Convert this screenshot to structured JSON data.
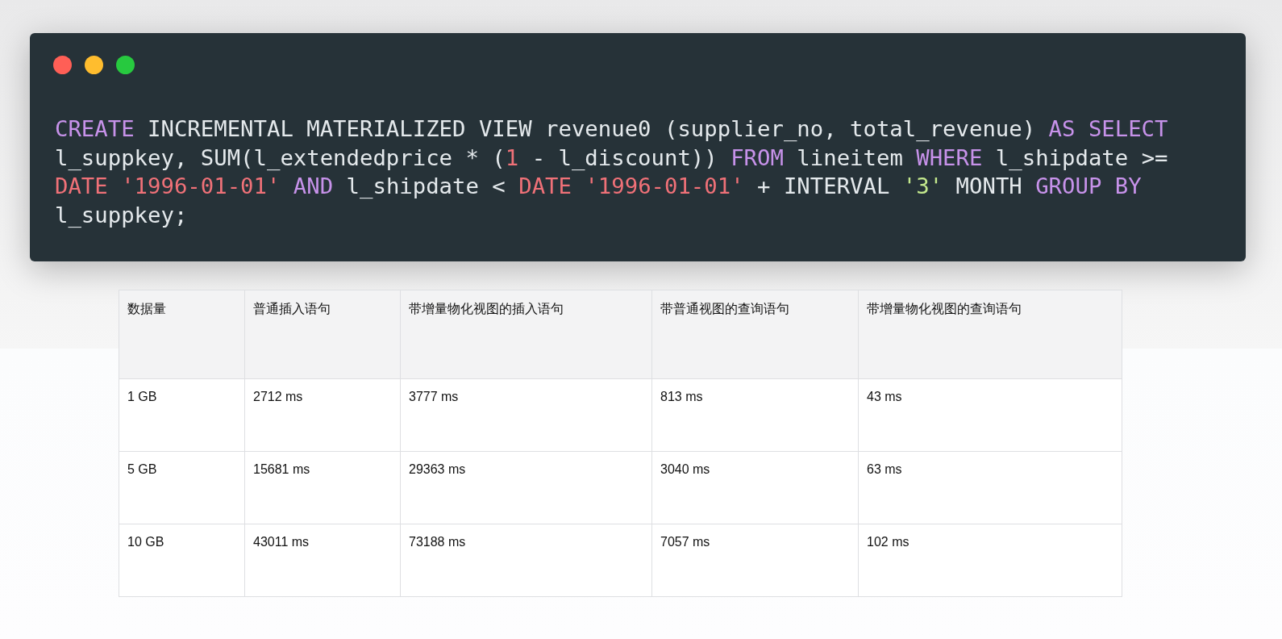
{
  "code_window": {
    "lines": [
      [
        {
          "kind": "keyword",
          "text": "CREATE"
        },
        {
          "kind": "plain",
          "text": " INCREMENTAL MATERIALIZED VIEW revenue0 (supplier_no, total_revenue) "
        },
        {
          "kind": "keyword",
          "text": "AS SELECT"
        }
      ],
      [
        {
          "kind": "plain",
          "text": "l_suppkey, SUM(l_extendedprice * ("
        },
        {
          "kind": "number",
          "text": "1"
        },
        {
          "kind": "plain",
          "text": " - l_discount)) "
        },
        {
          "kind": "keyword",
          "text": "FROM"
        },
        {
          "kind": "plain",
          "text": " lineitem "
        },
        {
          "kind": "keyword",
          "text": "WHERE"
        },
        {
          "kind": "plain",
          "text": " l_shipdate >="
        }
      ],
      [
        {
          "kind": "number",
          "text": "DATE '1996-01-01'"
        },
        {
          "kind": "keyword",
          "text": " AND"
        },
        {
          "kind": "plain",
          "text": " l_shipdate < "
        },
        {
          "kind": "number",
          "text": "DATE '1996-01-01'"
        },
        {
          "kind": "plain",
          "text": " + INTERVAL "
        },
        {
          "kind": "string",
          "text": "'3'"
        },
        {
          "kind": "plain",
          "text": " MONTH "
        },
        {
          "kind": "keyword",
          "text": "GROUP BY"
        }
      ],
      [
        {
          "kind": "plain",
          "text": "l_suppkey;"
        }
      ]
    ]
  },
  "table": {
    "columns": [
      "数据量",
      "普通插入语句",
      "带增量物化视图的插入语句",
      "带普通视图的查询语句",
      "带增量物化视图的查询语句"
    ],
    "rows": [
      [
        "1 GB",
        "2712 ms",
        "3777 ms",
        "813 ms",
        "43 ms"
      ],
      [
        "5 GB",
        "15681 ms",
        "29363 ms",
        "3040 ms",
        "63 ms"
      ],
      [
        "10 GB",
        "43011 ms",
        "73188 ms",
        "7057 ms",
        "102 ms"
      ]
    ]
  }
}
